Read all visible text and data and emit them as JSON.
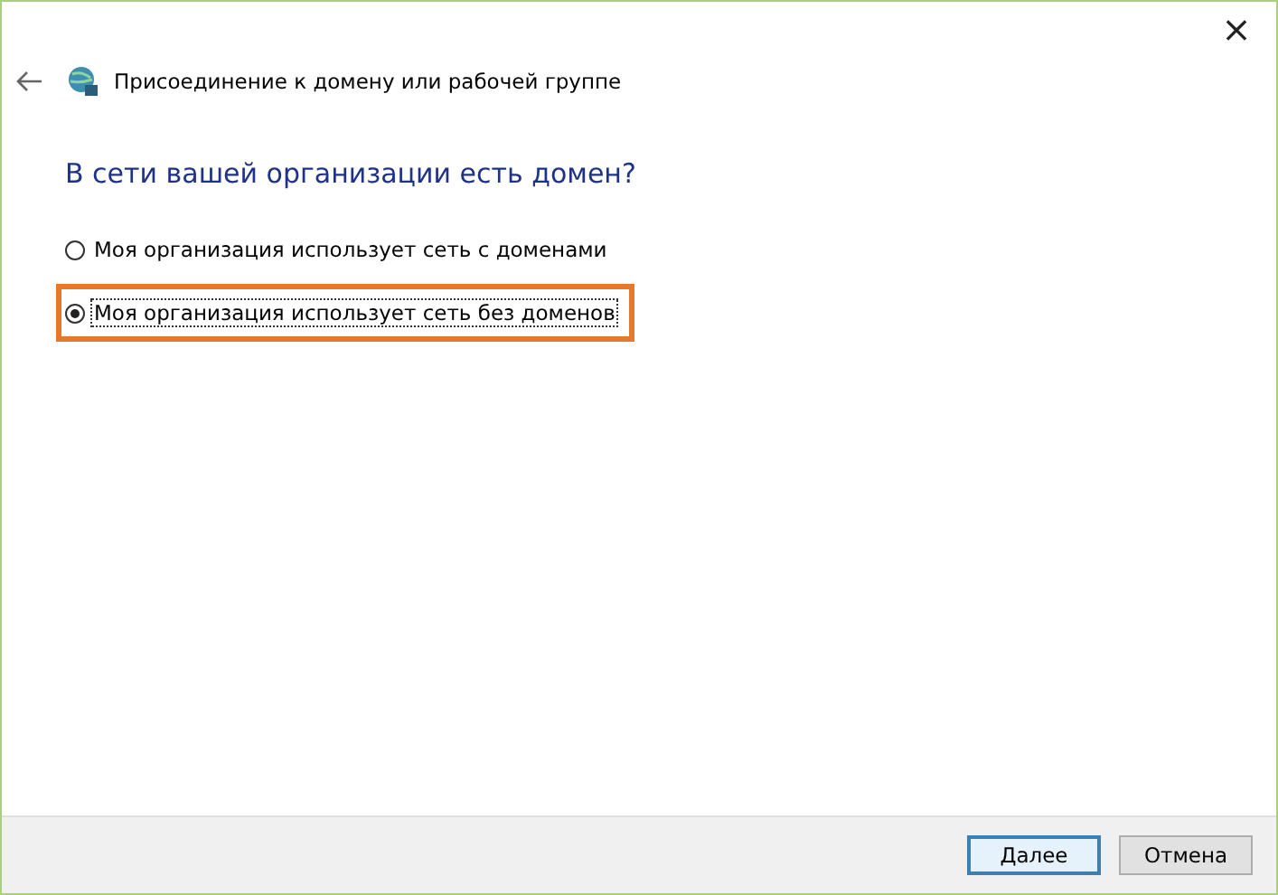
{
  "window": {
    "close": "×"
  },
  "header": {
    "title": "Присоединение к домену или рабочей группе"
  },
  "question": "В сети вашей организации есть домен?",
  "options": [
    {
      "label": "Моя организация использует сеть с доменами",
      "selected": false,
      "highlighted": false
    },
    {
      "label": "Моя организация использует сеть без доменов",
      "selected": true,
      "highlighted": true
    }
  ],
  "buttons": [
    {
      "label": "Далее",
      "kind": "default"
    },
    {
      "label": "Отмена",
      "kind": "normal"
    }
  ]
}
